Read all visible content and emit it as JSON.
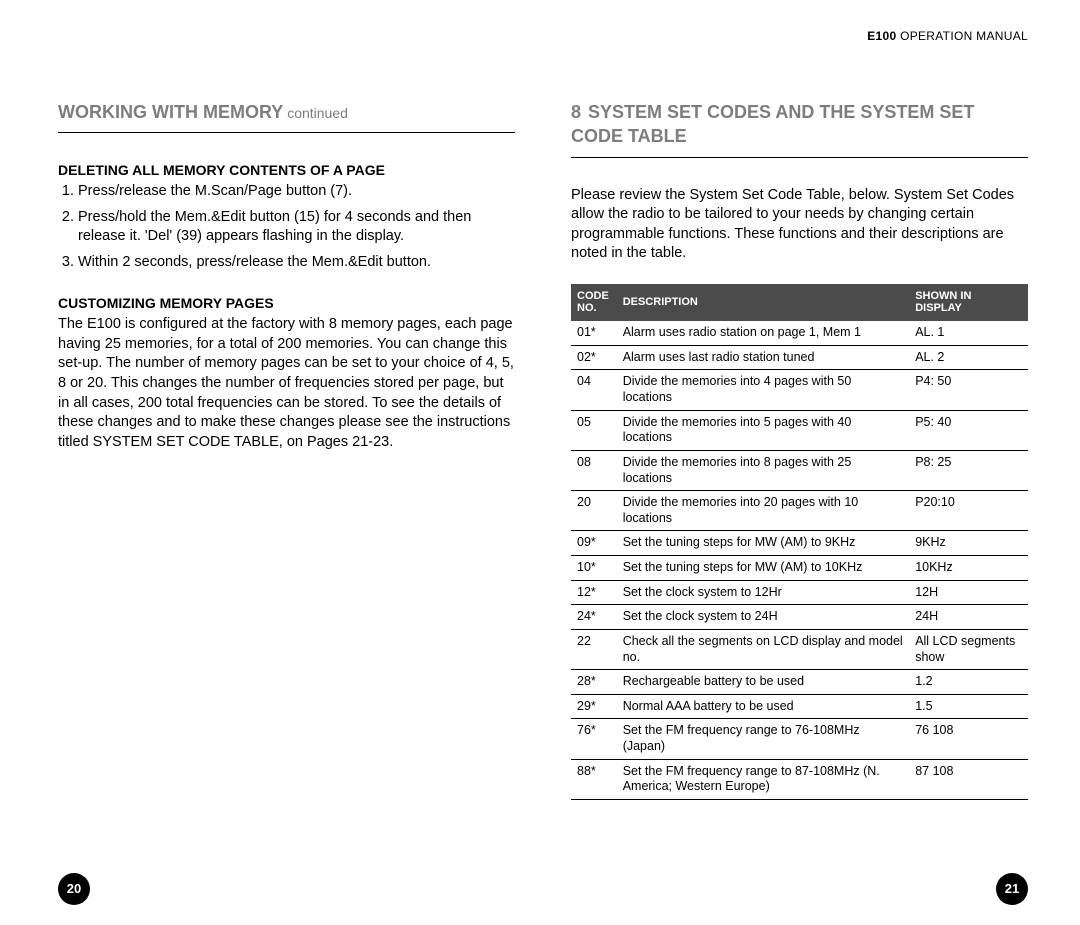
{
  "header": {
    "model": "E100",
    "rest": "OPERATION MANUAL"
  },
  "left": {
    "heading_main": "WORKING WITH MEMORY",
    "heading_cont": " continued",
    "subhead1": "DELETING ALL MEMORY CONTENTS OF A PAGE",
    "steps": {
      "s1": "Press/release the M.Scan/Page button (7).",
      "s2": "Press/hold the Mem.&Edit button (15) for 4 seconds and then release it. 'Del' (39) appears flashing in the display.",
      "s3": "Within 2 seconds, press/release the Mem.&Edit button."
    },
    "subhead2": "CUSTOMIZING MEMORY PAGES",
    "para2": "The E100 is configured at the factory with 8 memory pages, each page having 25 memories, for a total of 200 memories. You can change this set-up. The number of memory pages can be set to your choice of 4, 5, 8 or 20. This changes the number of frequencies stored per page, but in all cases, 200 total frequencies can be stored. To see the details of these changes and to make these changes please see the instructions titled SYSTEM SET CODE TABLE, on Pages 21-23."
  },
  "right": {
    "heading_num": "8",
    "heading_main": "SYSTEM SET CODES AND THE SYSTEM SET CODE TABLE",
    "intro": "Please review the System Set Code Table, below. System Set Codes allow the radio to be tailored to your needs by changing certain programmable functions. These functions and their descriptions are noted in the table.",
    "th1a": "CODE",
    "th1b": "NO.",
    "th2": "DESCRIPTION",
    "th3a": "SHOWN IN",
    "th3b": "DISPLAY"
  },
  "chart_data": {
    "type": "table",
    "columns": [
      "CODE NO.",
      "DESCRIPTION",
      "SHOWN IN DISPLAY"
    ],
    "rows": [
      {
        "code": "01*",
        "desc": "Alarm uses radio station on page 1, Mem 1",
        "disp": "AL. 1"
      },
      {
        "code": "02*",
        "desc": "Alarm uses last radio station tuned",
        "disp": "AL. 2"
      },
      {
        "code": "04",
        "desc": "Divide the memories into 4 pages with 50 locations",
        "disp": "P4: 50"
      },
      {
        "code": "05",
        "desc": "Divide the memories into 5 pages with 40 locations",
        "disp": "P5: 40"
      },
      {
        "code": "08",
        "desc": "Divide the memories into 8 pages with 25 locations",
        "disp": "P8: 25"
      },
      {
        "code": "20",
        "desc": "Divide the memories into 20 pages with 10 locations",
        "disp": "P20:10"
      },
      {
        "code": "09*",
        "desc": "Set the tuning steps for MW (AM) to 9KHz",
        "disp": "9KHz"
      },
      {
        "code": "10*",
        "desc": "Set the tuning steps for MW (AM) to 10KHz",
        "disp": "10KHz"
      },
      {
        "code": "12*",
        "desc": "Set the clock system to 12Hr",
        "disp": "12H"
      },
      {
        "code": "24*",
        "desc": "Set the clock system to 24H",
        "disp": "24H"
      },
      {
        "code": "22",
        "desc": "Check all the segments on LCD display and model no.",
        "disp": "All LCD segments show"
      },
      {
        "code": "28*",
        "desc": "Rechargeable battery to be used",
        "disp": "1.2"
      },
      {
        "code": "29*",
        "desc": "Normal AAA battery to be used",
        "disp": "1.5"
      },
      {
        "code": "76*",
        "desc": "Set the FM frequency range to 76-108MHz (Japan)",
        "disp": "76 108"
      },
      {
        "code": "88*",
        "desc": "Set the FM frequency range to 87-108MHz (N. America; Western Europe)",
        "disp": "87 108"
      }
    ]
  },
  "pagenums": {
    "left": "20",
    "right": "21"
  }
}
